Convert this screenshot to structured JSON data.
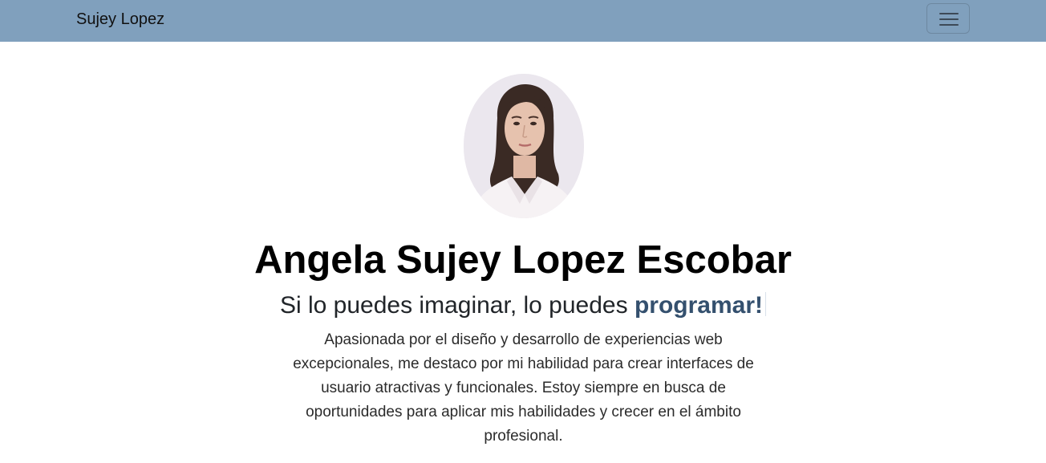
{
  "navbar": {
    "brand": "Sujey Lopez",
    "toggle_icon": "hamburger-menu-icon",
    "background_color": "#80a0bd"
  },
  "hero": {
    "avatar_alt": "profile-photo",
    "name": "Angela Sujey Lopez Escobar",
    "tagline_prefix": "Si lo puedes imaginar, lo puedes ",
    "tagline_highlight": "programar!",
    "highlight_color": "#34506e",
    "bio": "Apasionada por el diseño y desarrollo de experiencias web excepcionales, me destaco por mi habilidad para crear interfaces de usuario atractivas y funcionales. Estoy siempre en busca de oportunidades para aplicar mis habilidades y crecer en el ámbito profesional."
  }
}
